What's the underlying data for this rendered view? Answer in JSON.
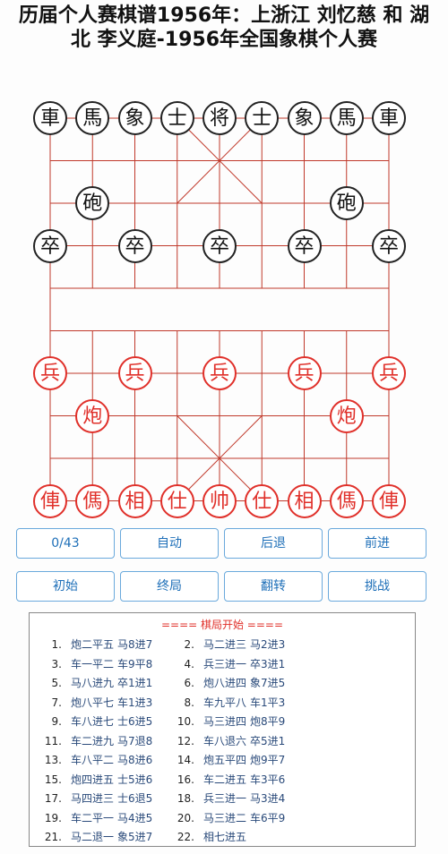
{
  "title": "历届个人赛棋谱1956年：上浙江 刘忆慈 和 湖北 李义庭-1956年全国象棋个人赛",
  "black_pieces": [
    {
      "char": "車",
      "col": 0,
      "row": 0
    },
    {
      "char": "馬",
      "col": 1,
      "row": 0
    },
    {
      "char": "象",
      "col": 2,
      "row": 0
    },
    {
      "char": "士",
      "col": 3,
      "row": 0
    },
    {
      "char": "将",
      "col": 4,
      "row": 0
    },
    {
      "char": "士",
      "col": 5,
      "row": 0
    },
    {
      "char": "象",
      "col": 6,
      "row": 0
    },
    {
      "char": "馬",
      "col": 7,
      "row": 0
    },
    {
      "char": "車",
      "col": 8,
      "row": 0
    },
    {
      "char": "砲",
      "col": 1,
      "row": 2
    },
    {
      "char": "砲",
      "col": 7,
      "row": 2
    },
    {
      "char": "卒",
      "col": 0,
      "row": 3
    },
    {
      "char": "卒",
      "col": 2,
      "row": 3
    },
    {
      "char": "卒",
      "col": 4,
      "row": 3
    },
    {
      "char": "卒",
      "col": 6,
      "row": 3
    },
    {
      "char": "卒",
      "col": 8,
      "row": 3
    }
  ],
  "red_pieces": [
    {
      "char": "兵",
      "col": 0,
      "row": 6
    },
    {
      "char": "兵",
      "col": 2,
      "row": 6
    },
    {
      "char": "兵",
      "col": 4,
      "row": 6
    },
    {
      "char": "兵",
      "col": 6,
      "row": 6
    },
    {
      "char": "兵",
      "col": 8,
      "row": 6
    },
    {
      "char": "炮",
      "col": 1,
      "row": 7
    },
    {
      "char": "炮",
      "col": 7,
      "row": 7
    },
    {
      "char": "俥",
      "col": 0,
      "row": 9
    },
    {
      "char": "傌",
      "col": 1,
      "row": 9
    },
    {
      "char": "相",
      "col": 2,
      "row": 9
    },
    {
      "char": "仕",
      "col": 3,
      "row": 9
    },
    {
      "char": "帅",
      "col": 4,
      "row": 9
    },
    {
      "char": "仕",
      "col": 5,
      "row": 9
    },
    {
      "char": "相",
      "col": 6,
      "row": 9
    },
    {
      "char": "傌",
      "col": 7,
      "row": 9
    },
    {
      "char": "俥",
      "col": 8,
      "row": 9
    }
  ],
  "controls": {
    "counter": "0/43",
    "auto": "自动",
    "back": "后退",
    "forward": "前进",
    "start": "初始",
    "end": "终局",
    "flip": "翻转",
    "challenge": "挑战"
  },
  "log": {
    "header": "==== 棋局开始 ====",
    "moves": [
      {
        "n": "1.",
        "a": "炮二平五",
        "b": "马8进7"
      },
      {
        "n": "2.",
        "a": "马二进三",
        "b": "马2进3"
      },
      {
        "n": "3.",
        "a": "车一平二",
        "b": "车9平8"
      },
      {
        "n": "4.",
        "a": "兵三进一",
        "b": "卒3进1"
      },
      {
        "n": "5.",
        "a": "马八进九",
        "b": "卒1进1"
      },
      {
        "n": "6.",
        "a": "炮八进四",
        "b": "象7进5"
      },
      {
        "n": "7.",
        "a": "炮八平七",
        "b": "车1进3"
      },
      {
        "n": "8.",
        "a": "车九平八",
        "b": "车1平3"
      },
      {
        "n": "9.",
        "a": "车八进七",
        "b": "士6进5"
      },
      {
        "n": "10.",
        "a": "马三进四",
        "b": "炮8平9"
      },
      {
        "n": "11.",
        "a": "车二进九",
        "b": "马7退8"
      },
      {
        "n": "12.",
        "a": "车八退六",
        "b": "卒5进1"
      },
      {
        "n": "13.",
        "a": "车八平二",
        "b": "马8进6"
      },
      {
        "n": "14.",
        "a": "炮五平四",
        "b": "炮9平7"
      },
      {
        "n": "15.",
        "a": "炮四进五",
        "b": "士5进6"
      },
      {
        "n": "16.",
        "a": "车二进五",
        "b": "车3平6"
      },
      {
        "n": "17.",
        "a": "马四进三",
        "b": "士6退5"
      },
      {
        "n": "18.",
        "a": "兵三进一",
        "b": "马3进4"
      },
      {
        "n": "19.",
        "a": "车二平一",
        "b": "马4进5"
      },
      {
        "n": "20.",
        "a": "马三进二",
        "b": "车6平9"
      },
      {
        "n": "21.",
        "a": "马二退一",
        "b": "象5进7"
      },
      {
        "n": "22.",
        "a": "相七进五",
        "b": ""
      }
    ]
  },
  "colors": {
    "red": "#e0302a",
    "black": "#222222",
    "accent": "#1e6fb8"
  }
}
